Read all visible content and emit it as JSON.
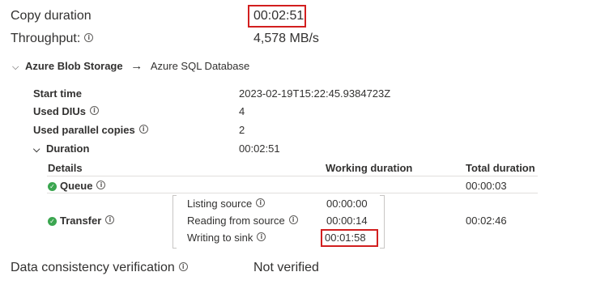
{
  "summary": {
    "copy_duration_label": "Copy duration",
    "copy_duration_value": "00:02:51",
    "throughput_label": "Throughput:",
    "throughput_value": "4,578 MB/s"
  },
  "route": {
    "source": "Azure Blob Storage",
    "arrow": "→",
    "sink": "Azure SQL Database"
  },
  "details": {
    "start_time_label": "Start time",
    "start_time_value": "2023-02-19T15:22:45.9384723Z",
    "used_dius_label": "Used DIUs",
    "used_dius_value": "4",
    "parallel_copies_label": "Used parallel copies",
    "parallel_copies_value": "2",
    "duration_label": "Duration",
    "duration_value": "00:02:51"
  },
  "table": {
    "headers": [
      "Details",
      "Working duration",
      "Total duration"
    ],
    "queue": {
      "label": "Queue",
      "total": "00:00:03"
    },
    "transfer": {
      "label": "Transfer",
      "total": "00:02:46",
      "steps": [
        {
          "label": "Listing source",
          "value": "00:00:00"
        },
        {
          "label": "Reading from source",
          "value": "00:00:14"
        },
        {
          "label": "Writing to sink",
          "value": "00:01:58"
        }
      ]
    }
  },
  "verification": {
    "label": "Data consistency verification",
    "value": "Not verified"
  },
  "icons": {
    "info": "info-icon",
    "check": "check-circle-icon",
    "chevron": "chevron-down-icon",
    "arrow": "arrow-right-icon"
  },
  "colors": {
    "highlight": "#d21f1f",
    "success": "#3ba650",
    "text": "#323130"
  }
}
